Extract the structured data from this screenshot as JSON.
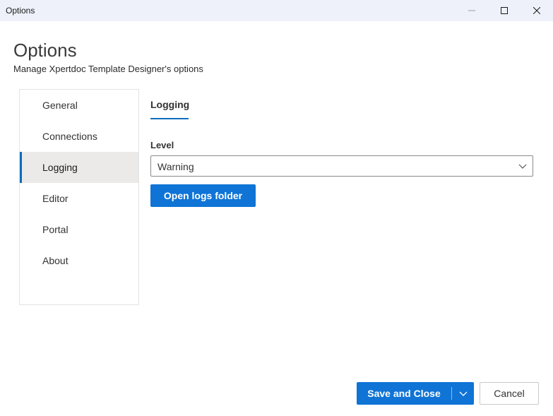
{
  "window": {
    "title": "Options",
    "controls": {
      "minimize_icon": "minimize-icon",
      "maximize_icon": "maximize-icon",
      "close_icon": "close-icon"
    }
  },
  "header": {
    "title": "Options",
    "subtitle": "Manage Xpertdoc Template Designer's options"
  },
  "sidebar": {
    "items": [
      {
        "label": "General",
        "active": false
      },
      {
        "label": "Connections",
        "active": false
      },
      {
        "label": "Logging",
        "active": true
      },
      {
        "label": "Editor",
        "active": false
      },
      {
        "label": "Portal",
        "active": false
      },
      {
        "label": "About",
        "active": false
      }
    ]
  },
  "main": {
    "tab": "Logging",
    "level_label": "Level",
    "level_value": "Warning",
    "open_logs_label": "Open logs folder"
  },
  "footer": {
    "save_close_label": "Save and Close",
    "cancel_label": "Cancel"
  },
  "colors": {
    "accent": "#0f74d6",
    "titlebar_bg": "#eef1f9",
    "active_item_bg": "#ebeae9"
  }
}
